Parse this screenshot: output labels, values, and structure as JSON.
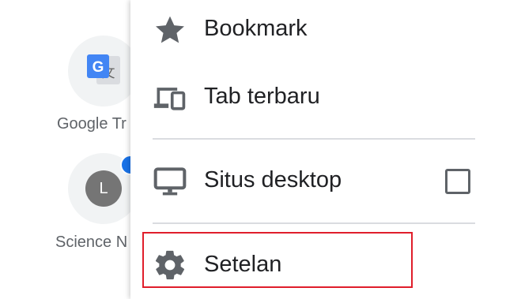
{
  "shortcuts": [
    {
      "title": "Google Tr",
      "icon": "google-translate-icon"
    },
    {
      "title": "Science N",
      "avatar_letter": "L",
      "badge_color": "#1a73e8"
    }
  ],
  "menu": {
    "items": [
      {
        "label": "Bookmark",
        "icon": "star-icon"
      },
      {
        "label": "Tab terbaru",
        "icon": "devices-icon"
      },
      {
        "label": "Situs desktop",
        "icon": "monitor-icon",
        "checked": false
      },
      {
        "label": "Setelan",
        "icon": "gear-icon",
        "highlighted": true
      }
    ]
  },
  "colors": {
    "highlight_border": "#e01e2b",
    "icon_gray": "#5f6368",
    "text_dark": "#202124"
  }
}
